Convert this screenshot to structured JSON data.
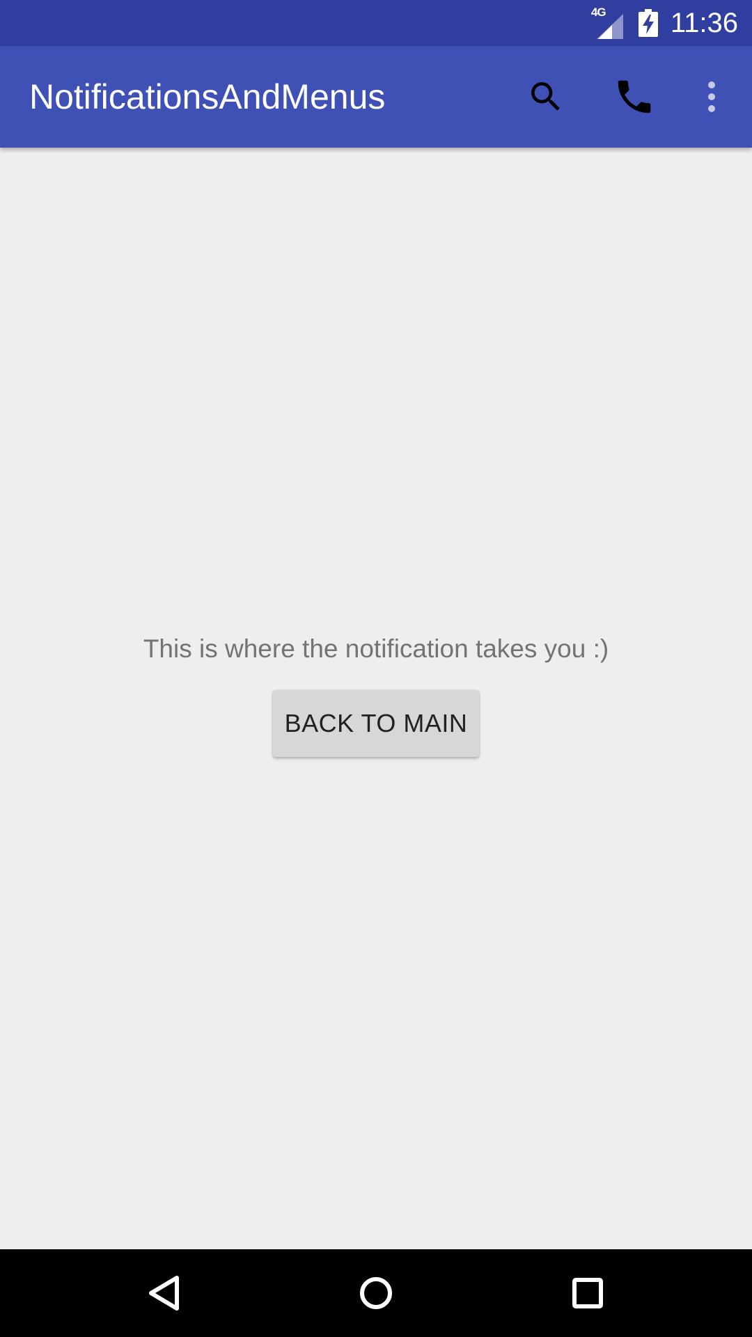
{
  "status_bar": {
    "network_type": "4G",
    "time": "11:36",
    "icons": [
      "signal-icon",
      "battery-charging-icon"
    ],
    "background": "#303f9f"
  },
  "app_bar": {
    "title": "NotificationsAndMenus",
    "background": "#3f51b5",
    "actions": [
      "search-icon",
      "phone-icon",
      "overflow-menu-icon"
    ]
  },
  "content": {
    "message": "This is where the notification takes you :)",
    "back_button_label": "BACK TO MAIN",
    "background": "#eeeeee"
  },
  "nav_bar": {
    "buttons": [
      "back-icon",
      "home-icon",
      "recents-icon"
    ],
    "background": "#000000"
  }
}
